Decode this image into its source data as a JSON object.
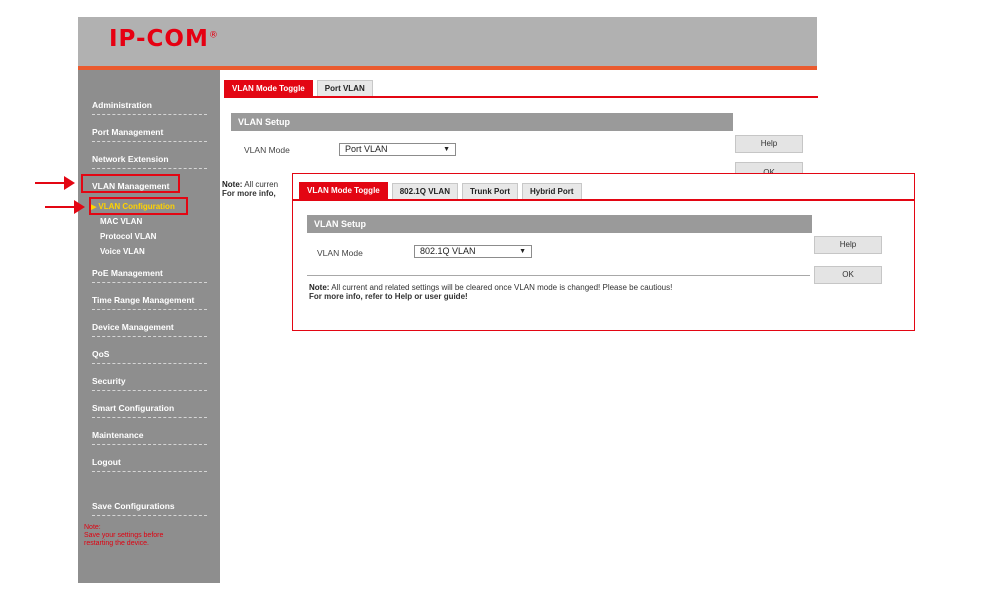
{
  "brand": {
    "logo_text": "IP-COM",
    "registered": "®"
  },
  "sidebar": {
    "items": [
      {
        "id": "administration",
        "label": "Administration"
      },
      {
        "id": "port-management",
        "label": "Port Management"
      },
      {
        "id": "network-extension",
        "label": "Network Extension"
      },
      {
        "id": "vlan-management",
        "label": "VLAN Management"
      },
      {
        "id": "poe-management",
        "label": "PoE Management"
      },
      {
        "id": "time-range-management",
        "label": "Time Range Management"
      },
      {
        "id": "device-management",
        "label": "Device Management"
      },
      {
        "id": "qos",
        "label": "QoS"
      },
      {
        "id": "security",
        "label": "Security"
      },
      {
        "id": "smart-configuration",
        "label": "Smart Configuration"
      },
      {
        "id": "maintenance",
        "label": "Maintenance"
      },
      {
        "id": "logout",
        "label": "Logout"
      },
      {
        "id": "save-configurations",
        "label": "Save Configurations"
      }
    ],
    "vlan_sub_items": [
      {
        "id": "vlan-configuration",
        "label": "VLAN Configuration",
        "active": true
      },
      {
        "id": "mac-vlan",
        "label": "MAC VLAN"
      },
      {
        "id": "protocol-vlan",
        "label": "Protocol VLAN"
      },
      {
        "id": "voice-vlan",
        "label": "Voice VLAN"
      }
    ],
    "note": {
      "title": "Note:",
      "line1": "Save your settings before",
      "line2": "restarting the device."
    }
  },
  "main": {
    "tabs": [
      {
        "label": "VLAN Mode Toggle",
        "active": true
      },
      {
        "label": "Port VLAN"
      }
    ],
    "section_title": "VLAN Setup",
    "vlan_mode_label": "VLAN Mode",
    "vlan_mode_value": "Port VLAN",
    "help_label": "Help",
    "ok_label": "OK",
    "note_title": "Note:",
    "note_line1_partial": "All curren",
    "note_line2_partial": "For more info,"
  },
  "overlay": {
    "tabs": [
      {
        "label": "VLAN Mode Toggle",
        "active": true
      },
      {
        "label": "802.1Q VLAN"
      },
      {
        "label": "Trunk Port"
      },
      {
        "label": "Hybrid Port"
      }
    ],
    "section_title": "VLAN Setup",
    "vlan_mode_label": "VLAN Mode",
    "vlan_mode_value": "802.1Q VLAN",
    "help_label": "Help",
    "ok_label": "OK",
    "note_title": "Note:",
    "note_line1": "All current and related settings will be cleared once VLAN mode is changed! Please be cautious!",
    "note_line2": "For more info, refer to Help or user guide!"
  },
  "icons": {
    "caret": "▼",
    "active_marker": "▶"
  },
  "colors": {
    "accent": "#e30613",
    "sidebar_bg": "#8e8e8e",
    "header_bg": "#b1b1b1",
    "header_line": "#ea5a2e",
    "active_sub": "#ffd200"
  }
}
